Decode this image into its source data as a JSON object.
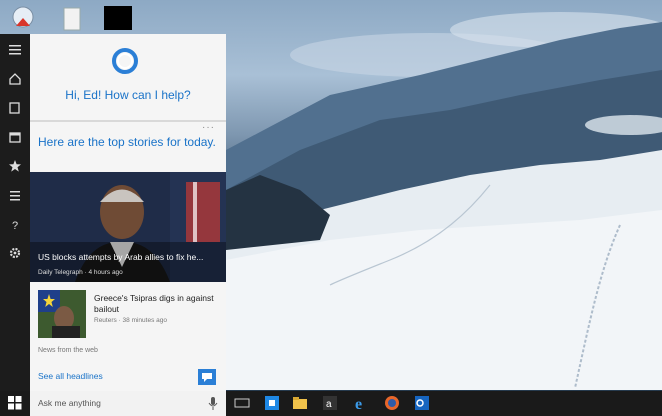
{
  "desktop": {
    "icons": [
      "recycle-bin-icon",
      "document-icon",
      "app-icon"
    ]
  },
  "rail": {
    "icons": [
      "hamburger-icon",
      "home-icon",
      "notebook-icon",
      "calendar-icon",
      "star-icon",
      "feed-icon",
      "help-icon",
      "gear-icon"
    ]
  },
  "cortana": {
    "greeting": "Hi, Ed! How can I help?",
    "top_stories_heading": "Here are the top stories for today.",
    "stories": [
      {
        "title": "US blocks attempts by Arab allies to fix he...",
        "source": "Daily Telegraph · 4 hours ago"
      },
      {
        "title": "Greece's Tsipras digs in against bailout",
        "source": "Reuters · 38 minutes ago"
      }
    ],
    "news_from_web": "News from the web",
    "see_all": "See all headlines"
  },
  "taskbar": {
    "search_placeholder": "Ask me anything",
    "apps": [
      "task-view-icon",
      "store-icon",
      "file-explorer-icon",
      "amazon-icon",
      "edge-icon",
      "firefox-icon",
      "outlook-icon"
    ]
  },
  "colors": {
    "accent": "#2b7fd6",
    "link": "#1a73c8",
    "panel_bg": "#f5f5f5",
    "taskbar_bg": "#1a1a1a"
  }
}
